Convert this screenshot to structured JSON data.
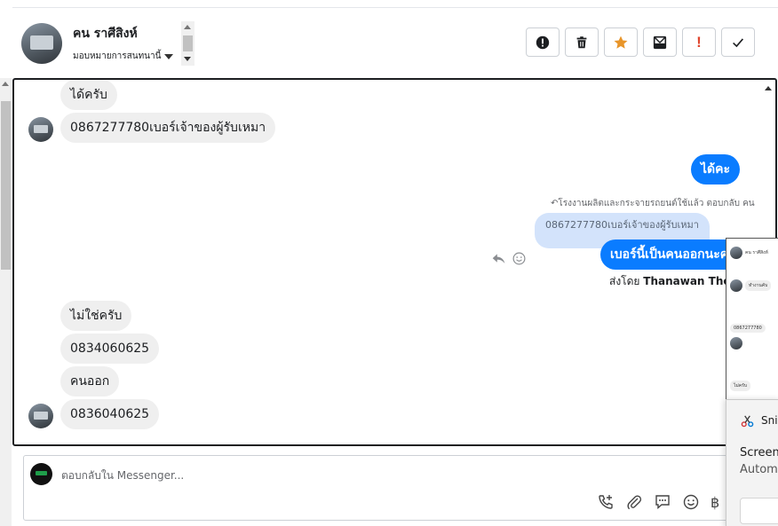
{
  "header": {
    "contact_name": "คน ราศีสิงห์",
    "assign_label": "มอบหมายการสนทนานี้"
  },
  "actions": [
    {
      "name": "alert-circle-icon"
    },
    {
      "name": "trash-icon"
    },
    {
      "name": "star-icon",
      "color": "#e8952a"
    },
    {
      "name": "mail-archive-icon"
    },
    {
      "name": "exclamation-icon",
      "label": "!",
      "color": "#e0452d"
    },
    {
      "name": "checkmark-icon"
    }
  ],
  "messages": {
    "in_1": "ได้ครับ",
    "in_2": "0867277780เบอร์เจ้าของผู้รับเหมา",
    "out_1": "ได้คะ",
    "reply_note": "โรงงานผลิตและกระจายรถยนต์ใช้แล้ว ตอบกลับ คน",
    "quoted": "0867277780เบอร์เจ้าของผู้รับเหมา",
    "out_2": "เบอร์นี้เป็นคนออกนะคะ",
    "sent_by_prefix": "ส่งโดย",
    "sent_by_name": "Thanawan Thon",
    "in_3": "ไม่ใช่ครับ",
    "in_4": "0834060625",
    "in_5": "คนออก",
    "in_6": "0836040625"
  },
  "composer": {
    "placeholder": "ตอบกลับใน Messenger...",
    "currency_symbol": "฿"
  },
  "preview": {
    "row_1": "คน ราศีสิงห์",
    "row_2": "ทำงานคับ",
    "row_3": "0867277780",
    "row_4": "ไม่ครับ"
  },
  "snip_notification": {
    "app_name": "Snip",
    "title": "Screens",
    "subtitle": "Autom"
  },
  "colors": {
    "accent_blue": "#0a7cff",
    "quote_bg": "#d3e3fb",
    "incoming_bg": "#efefef"
  }
}
